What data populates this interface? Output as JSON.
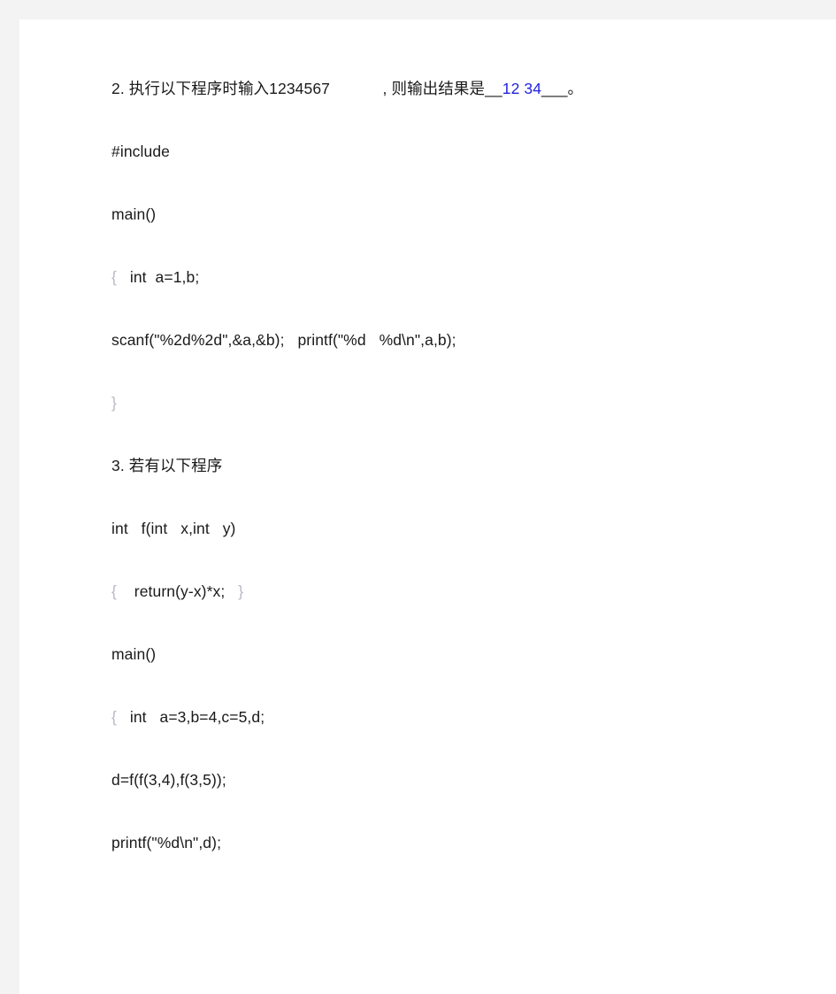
{
  "page": {
    "background_color": "#f3f3f4",
    "sheet_color": "#ffffff",
    "text_color": "#1a1a1a",
    "brace_color": "#b9b9c4",
    "answer_color": "#2222dd"
  },
  "questions": [
    {
      "number": "2.",
      "prompt_before_input": " 执行以下程序时输入1234567",
      "prompt_gap": "            ",
      "prompt_after_input": ", 则输出结果是",
      "blank_prefix": "__",
      "answer": "12 34",
      "blank_suffix": "___",
      "trailing_punctuation": "。",
      "code_lines": [
        {
          "brace": "",
          "text": "#include"
        },
        {
          "brace": "",
          "text": "main()"
        },
        {
          "brace": "{",
          "text": "   int  a=1,b;"
        },
        {
          "brace": "",
          "text": "scanf(\"%2d%2d\",&a,&b);   printf(\"%d   %d\\n\",a,b);"
        },
        {
          "brace": "}",
          "text": ""
        }
      ]
    },
    {
      "number": "3.",
      "title": " 若有以下程序",
      "code_lines": [
        {
          "brace": "",
          "text": "int   f(int   x,int   y)"
        },
        {
          "brace": "{",
          "text": "    return(y-x)*x;   ",
          "brace_end": "}"
        },
        {
          "brace": "",
          "text": "main()"
        },
        {
          "brace": "{",
          "text": "   int   a=3,b=4,c=5,d;"
        },
        {
          "brace": "",
          "text": "d=f(f(3,4),f(3,5));"
        },
        {
          "brace": "",
          "text": "printf(\"%d\\n\",d);"
        }
      ]
    }
  ]
}
